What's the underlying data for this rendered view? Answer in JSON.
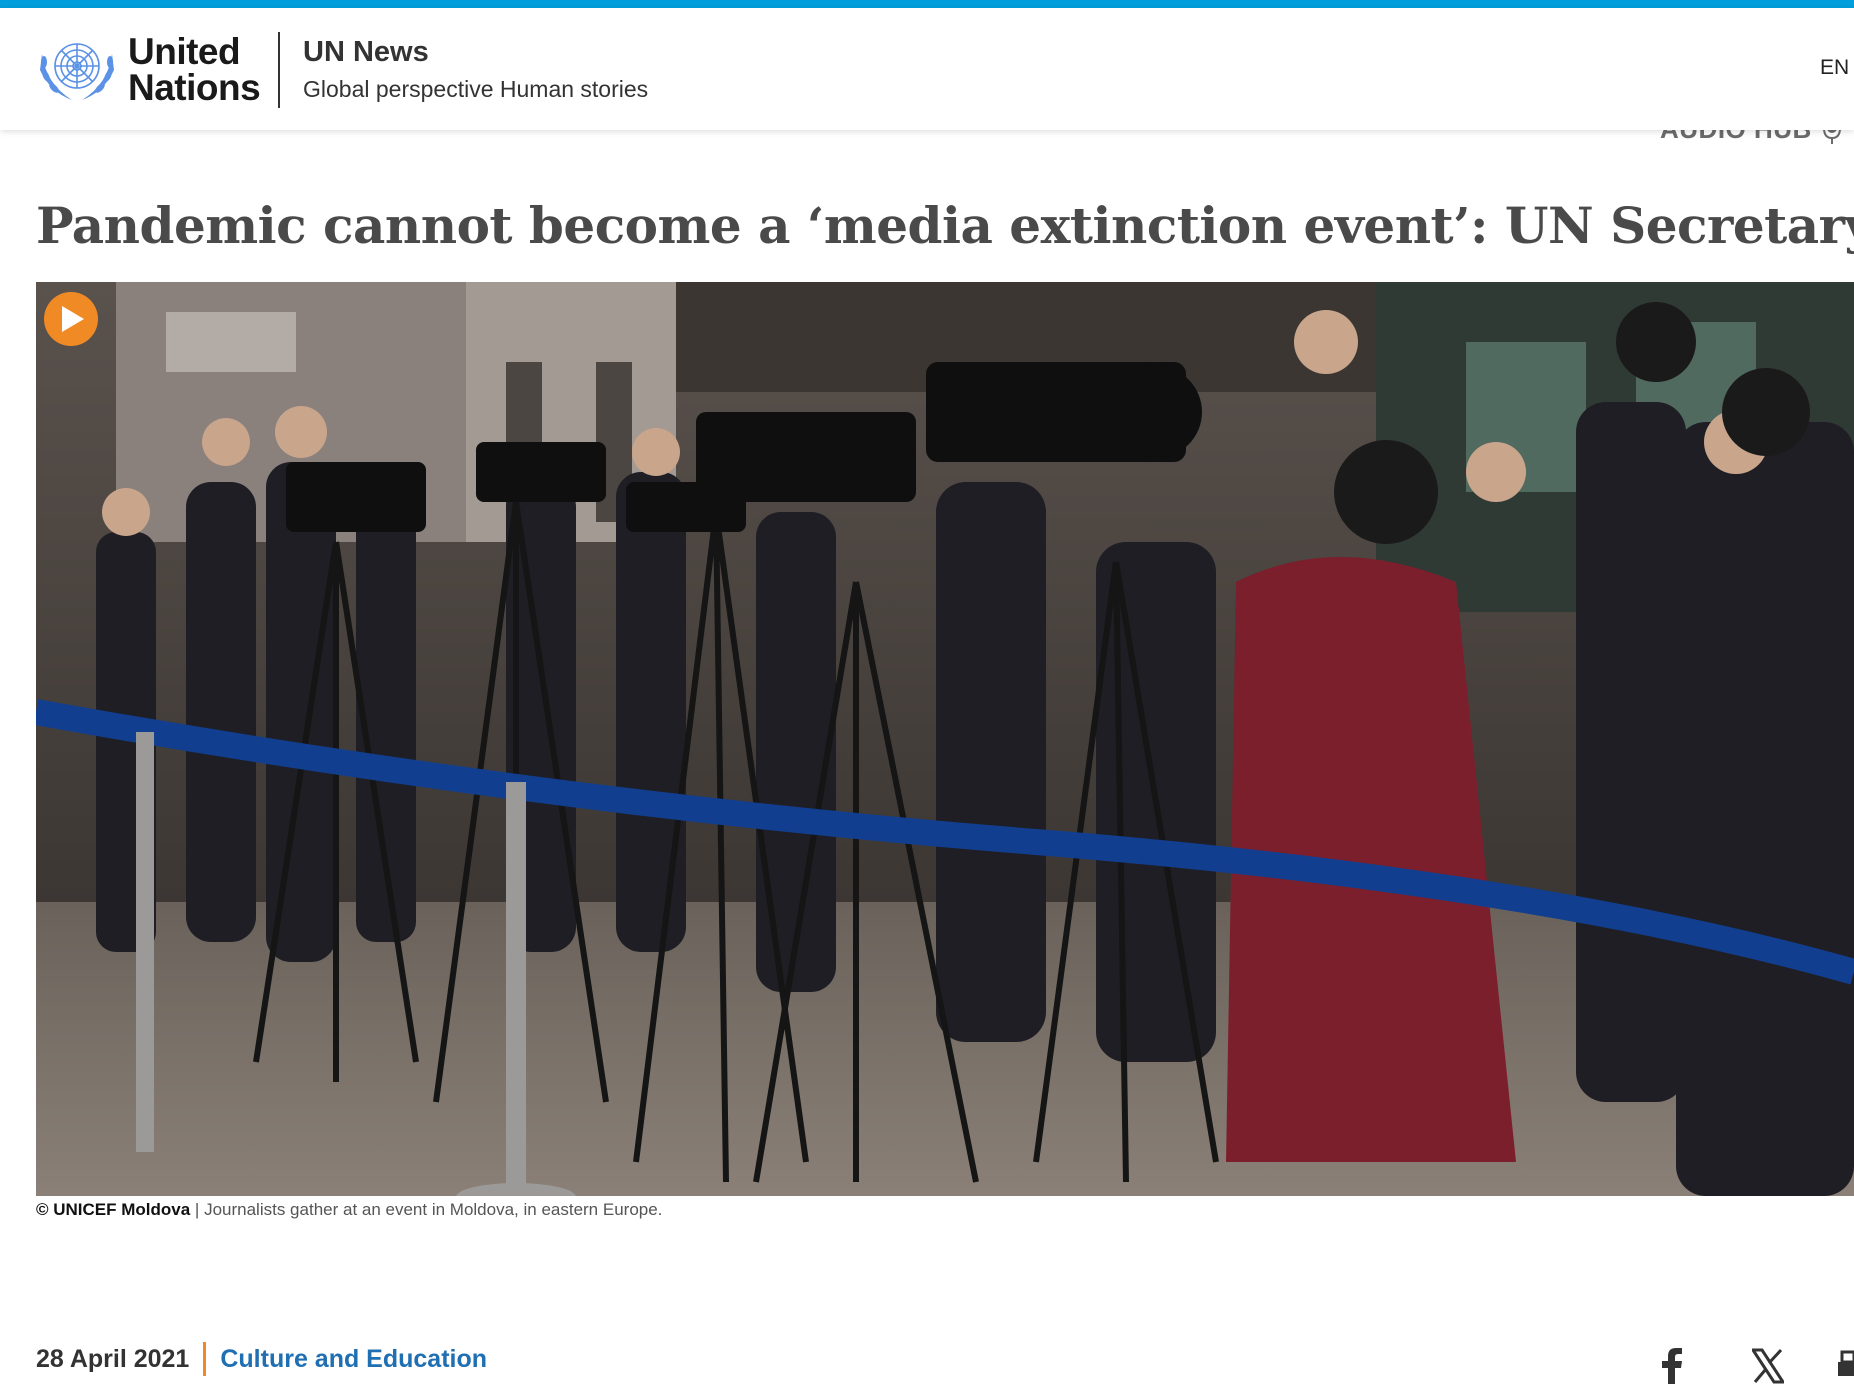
{
  "header": {
    "logo_line1": "United",
    "logo_line2": "Nations",
    "site_name": "UN News",
    "tagline": "Global perspective Human stories",
    "language": "EN"
  },
  "audio_hub": {
    "label": "AUDIO HUB"
  },
  "article": {
    "headline": "Pandemic cannot become a ‘media extinction event’: UN Secretary-General",
    "image_credit": "© UNICEF Moldova",
    "caption_separator": " | ",
    "image_caption": "Journalists gather at an event in Moldova, in eastern Europe.",
    "date": "28 April 2021",
    "topic": "Culture and Education"
  },
  "share": {
    "icons": [
      "facebook-icon",
      "x-icon",
      "print-icon"
    ]
  },
  "colors": {
    "accent_blue": "#009edb",
    "topic_blue": "#1f6fb2",
    "orange": "#f08a24",
    "headline_gray": "#4a4a4a"
  }
}
